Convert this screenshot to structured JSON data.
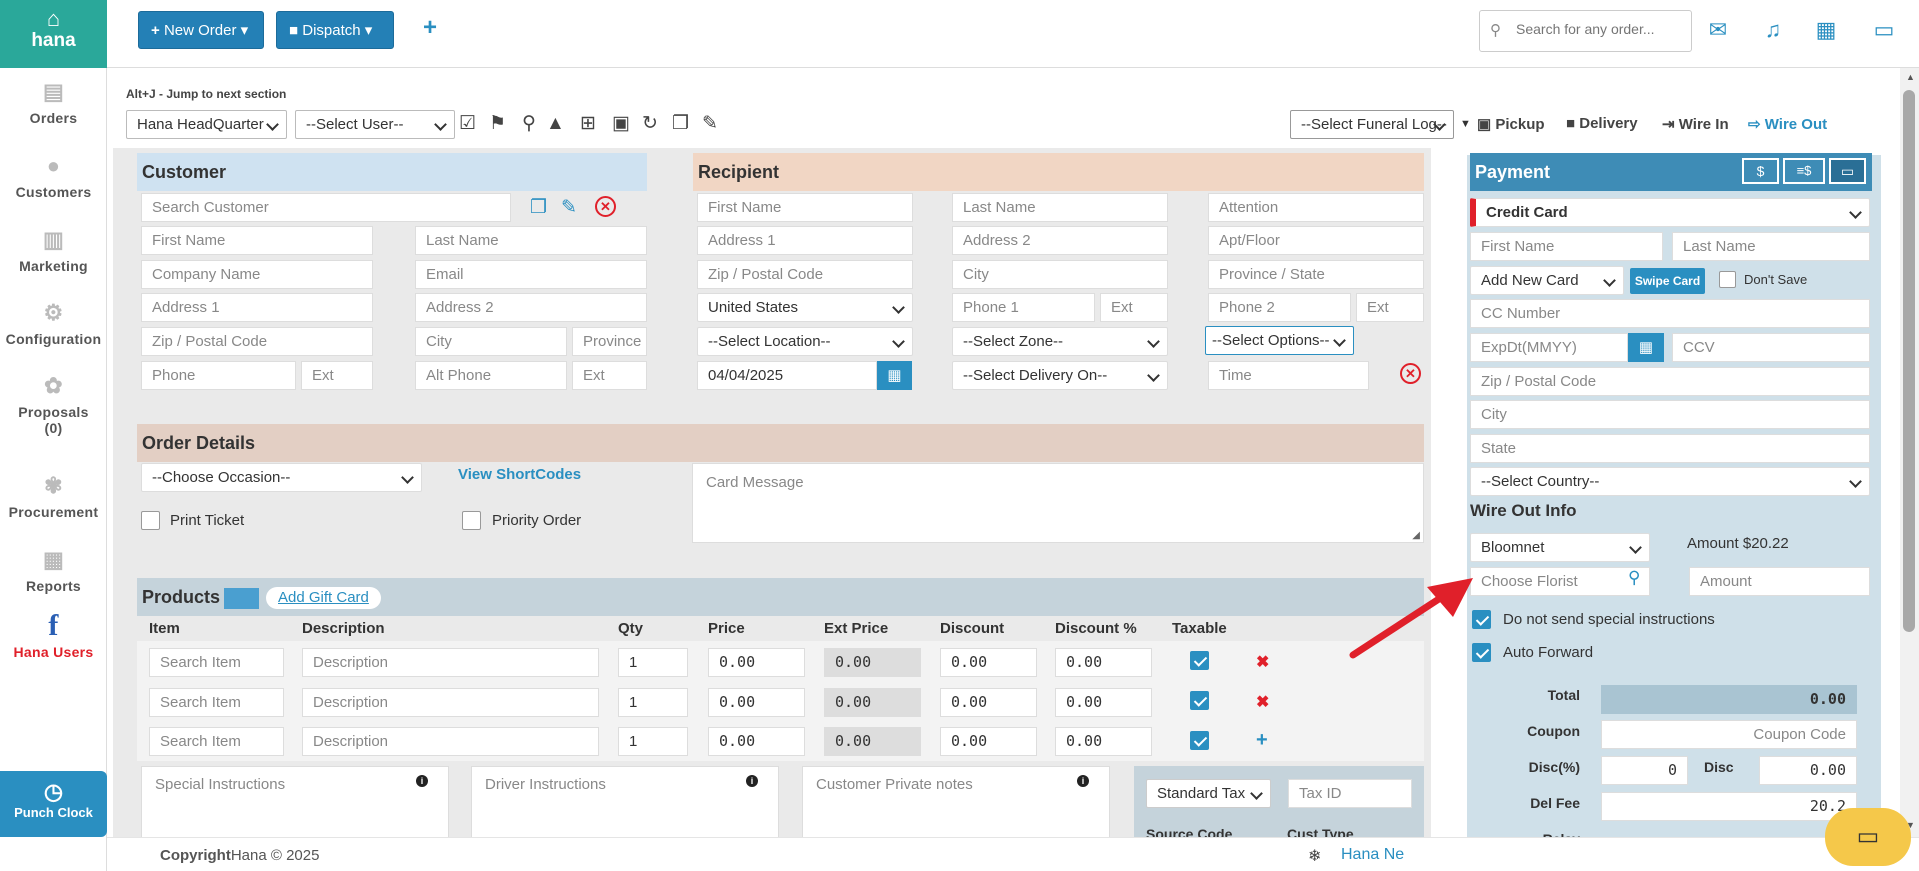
{
  "app": {
    "name": "hana"
  },
  "sidebar": {
    "items": [
      {
        "label": "Orders",
        "icon": "orders-icon"
      },
      {
        "label": "Customers",
        "icon": "customers-icon"
      },
      {
        "label": "Marketing",
        "icon": "marketing-icon"
      },
      {
        "label": "Configuration",
        "icon": "gear-icon"
      },
      {
        "label": "Proposals",
        "icon": "proposals-icon"
      },
      {
        "label": "(0)",
        "icon": ""
      },
      {
        "label": "Procurement",
        "icon": "procurement-icon"
      },
      {
        "label": "Reports",
        "icon": "reports-icon"
      },
      {
        "label": "Hana Users",
        "icon": "facebook-icon"
      }
    ],
    "punch_label": "Punch Clock"
  },
  "topbar": {
    "new_order": "New Order",
    "dispatch": "Dispatch",
    "search_placeholder": "Search for any order..."
  },
  "toolbar": {
    "hint": "Alt+J - Jump to next section",
    "store": "Hana HeadQuarter",
    "user": "--Select User--",
    "funeral": "--Select Funeral Log--",
    "pickup": "Pickup",
    "delivery": "Delivery",
    "wire_in": "Wire In",
    "wire_out": "Wire Out"
  },
  "customer": {
    "title": "Customer",
    "search": "Search Customer",
    "first": "First Name",
    "last": "Last Name",
    "company": "Company Name",
    "email": "Email",
    "addr1": "Address 1",
    "addr2": "Address 2",
    "zip": "Zip / Postal Code",
    "city": "City",
    "province": "Province",
    "phone": "Phone",
    "ext": "Ext",
    "alt_phone": "Alt Phone",
    "ext2": "Ext"
  },
  "recipient": {
    "title": "Recipient",
    "first": "First Name",
    "last": "Last Name",
    "attention": "Attention",
    "addr1": "Address 1",
    "addr2": "Address 2",
    "apt": "Apt/Floor",
    "zip": "Zip / Postal Code",
    "city": "City",
    "province": "Province / State",
    "country": "United States",
    "phone1": "Phone 1",
    "ext1": "Ext",
    "phone2": "Phone 2",
    "ext2": "Ext",
    "location": "--Select Location--",
    "zone": "--Select Zone--",
    "options": "--Select Options--",
    "date": "04/04/2025",
    "delivery_on": "--Select Delivery On--",
    "time": "Time"
  },
  "order": {
    "title": "Order Details",
    "occasion": "--Choose Occasion--",
    "shortcodes": "View ShortCodes",
    "card_message": "Card Message",
    "print_ticket": "Print Ticket",
    "priority": "Priority Order"
  },
  "products": {
    "title": "Products",
    "add_gift": "Add Gift Card",
    "headers": [
      "Item",
      "Description",
      "Qty",
      "Price",
      "Ext Price",
      "Discount",
      "Discount %",
      "Taxable"
    ],
    "rows": [
      {
        "item": "Search Item",
        "desc": "Description",
        "qty": "1",
        "price": "0.00",
        "ext": "0.00",
        "disc": "0.00",
        "pct": "0.00",
        "action": "✖"
      },
      {
        "item": "Search Item",
        "desc": "Description",
        "qty": "1",
        "price": "0.00",
        "ext": "0.00",
        "disc": "0.00",
        "pct": "0.00",
        "action": "✖"
      },
      {
        "item": "Search Item",
        "desc": "Description",
        "qty": "1",
        "price": "0.00",
        "ext": "0.00",
        "disc": "0.00",
        "pct": "0.00",
        "action": "+"
      }
    ],
    "special": "Special Instructions",
    "driver": "Driver Instructions",
    "private": "Customer Private notes",
    "tax": "Standard Tax",
    "tax_id": "Tax ID",
    "source_code": "Source Code",
    "cust_type": "Cust Type"
  },
  "payment": {
    "title": "Payment",
    "method": "Credit Card",
    "first": "First Name",
    "last": "Last Name",
    "card": "Add New Card",
    "swipe": "Swipe Card",
    "dont_save": "Don't Save",
    "cc": "CC Number",
    "exp": "ExpDt(MMYY)",
    "ccv": "CCV",
    "zip": "Zip / Postal Code",
    "city": "City",
    "state": "State",
    "country": "--Select Country--",
    "wire_title": "Wire Out Info",
    "wire_service": "Bloomnet",
    "amount_label": "Amount $20.22",
    "florist": "Choose Florist",
    "amount": "Amount",
    "no_special": "Do not send special instructions",
    "auto_forward": "Auto Forward",
    "total_label": "Total",
    "total": "0.00",
    "coupon_label": "Coupon",
    "coupon": "Coupon Code",
    "disc_pct_label": "Disc(%)",
    "disc_pct": "0",
    "disc_label": "Disc",
    "disc": "0.00",
    "delfee_label": "Del Fee",
    "delfee": "20.2",
    "relay_label": "Relay"
  },
  "footer": {
    "copyright_bold": "Copyright",
    "copyright": "Hana © 2025",
    "news": "Hana Ne"
  }
}
